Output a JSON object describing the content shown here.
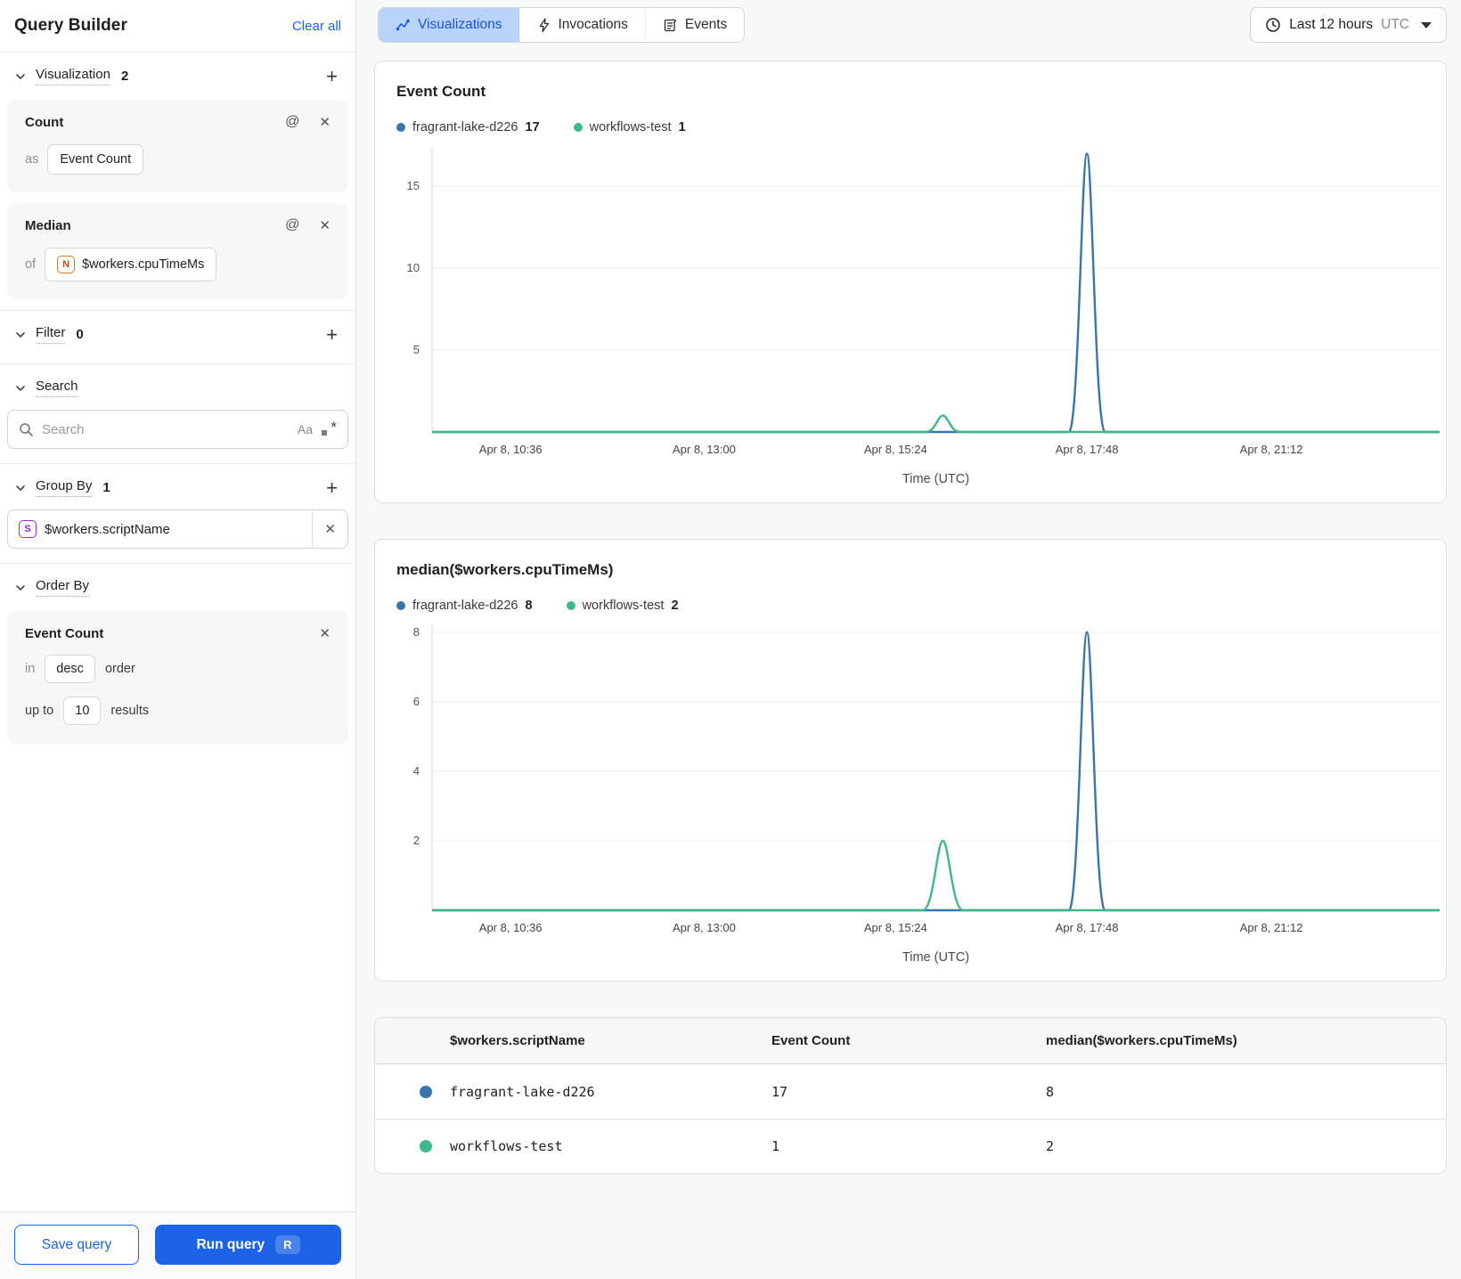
{
  "sidebar": {
    "title": "Query Builder",
    "clear_all": "Clear all",
    "sections": {
      "visualization": {
        "label": "Visualization",
        "count": "2"
      },
      "filter": {
        "label": "Filter",
        "count": "0"
      },
      "search": {
        "label": "Search"
      },
      "group_by": {
        "label": "Group By",
        "count": "1"
      },
      "order_by": {
        "label": "Order By"
      }
    },
    "visualizations": [
      {
        "title": "Count",
        "prefix": "as",
        "value": "Event Count"
      },
      {
        "title": "Median",
        "prefix": "of",
        "field_badge": "N",
        "value": "$workers.cpuTimeMs"
      }
    ],
    "search": {
      "placeholder": "Search",
      "case_toggle": "Aa"
    },
    "group_by_field": {
      "badge": "S",
      "value": "$workers.scriptName"
    },
    "order_by_card": {
      "title": "Event Count",
      "in_label": "in",
      "direction": "desc",
      "order_label": "order",
      "upto_label": "up to",
      "limit": "10",
      "results_label": "results"
    },
    "save_button": "Save query",
    "run_button": "Run query",
    "run_shortcut": "R"
  },
  "header": {
    "tabs": [
      {
        "label": "Visualizations",
        "active": true
      },
      {
        "label": "Invocations",
        "active": false
      },
      {
        "label": "Events",
        "active": false
      }
    ],
    "time_range": "Last 12 hours",
    "timezone": "UTC"
  },
  "chart_data": [
    {
      "type": "line",
      "title": "Event Count",
      "xlabel": "Time (UTC)",
      "ylim": [
        0,
        17.4
      ],
      "y_ticks": [
        5,
        10,
        15
      ],
      "x_ticks": [
        {
          "label": "Apr 8, 10:36",
          "f": 0.078
        },
        {
          "label": "Apr 8, 13:00",
          "f": 0.27
        },
        {
          "label": "Apr 8, 15:24",
          "f": 0.46
        },
        {
          "label": "Apr 8, 17:48",
          "f": 0.65
        },
        {
          "label": "Apr 8, 21:12",
          "f": 0.833
        }
      ],
      "series": [
        {
          "name": "fragrant-lake-d226",
          "total": "17",
          "color": "#3a74ad",
          "baseline_value": 0,
          "peaks": [
            {
              "time": "Apr 8, 17:48",
              "value": 17,
              "f": 0.65,
              "halfwidth": 0.018
            }
          ]
        },
        {
          "name": "workflows-test",
          "total": "1",
          "color": "#3cb98b",
          "baseline_value": 0,
          "peaks": [
            {
              "time": "Apr 8, 15:45",
              "value": 1,
              "f": 0.507,
              "halfwidth": 0.017
            }
          ]
        }
      ],
      "legend_position": "top",
      "grid": true
    },
    {
      "type": "line",
      "title": "median($workers.cpuTimeMs)",
      "xlabel": "Time (UTC)",
      "ylim": [
        0,
        8.2
      ],
      "y_ticks": [
        2,
        4,
        6,
        8
      ],
      "x_ticks": [
        {
          "label": "Apr 8, 10:36",
          "f": 0.078
        },
        {
          "label": "Apr 8, 13:00",
          "f": 0.27
        },
        {
          "label": "Apr 8, 15:24",
          "f": 0.46
        },
        {
          "label": "Apr 8, 17:48",
          "f": 0.65
        },
        {
          "label": "Apr 8, 21:12",
          "f": 0.833
        }
      ],
      "series": [
        {
          "name": "fragrant-lake-d226",
          "total": "8",
          "color": "#3a74ad",
          "baseline_value": 0,
          "peaks": [
            {
              "time": "Apr 8, 17:48",
              "value": 8,
              "f": 0.65,
              "halfwidth": 0.018
            }
          ]
        },
        {
          "name": "workflows-test",
          "total": "2",
          "color": "#3cb98b",
          "baseline_value": 0,
          "peaks": [
            {
              "time": "Apr 8, 15:45",
              "value": 2,
              "f": 0.507,
              "halfwidth": 0.02
            }
          ]
        }
      ],
      "legend_position": "top",
      "grid": true
    }
  ],
  "table": {
    "columns": [
      "$workers.scriptName",
      "Event Count",
      "median($workers.cpuTimeMs)"
    ],
    "rows": [
      {
        "dot_color": "#3a74ad",
        "name": "fragrant-lake-d226",
        "event_count": "17",
        "median": "8"
      },
      {
        "dot_color": "#3cb98b",
        "name": "workflows-test",
        "event_count": "1",
        "median": "2"
      }
    ]
  },
  "colors": {
    "accent_blue": "#1d63e8",
    "tab_active_bg": "#b9d3fb",
    "tab_active_text": "#1a56db",
    "series_blue": "#3a74ad",
    "series_green": "#3cb98b"
  }
}
